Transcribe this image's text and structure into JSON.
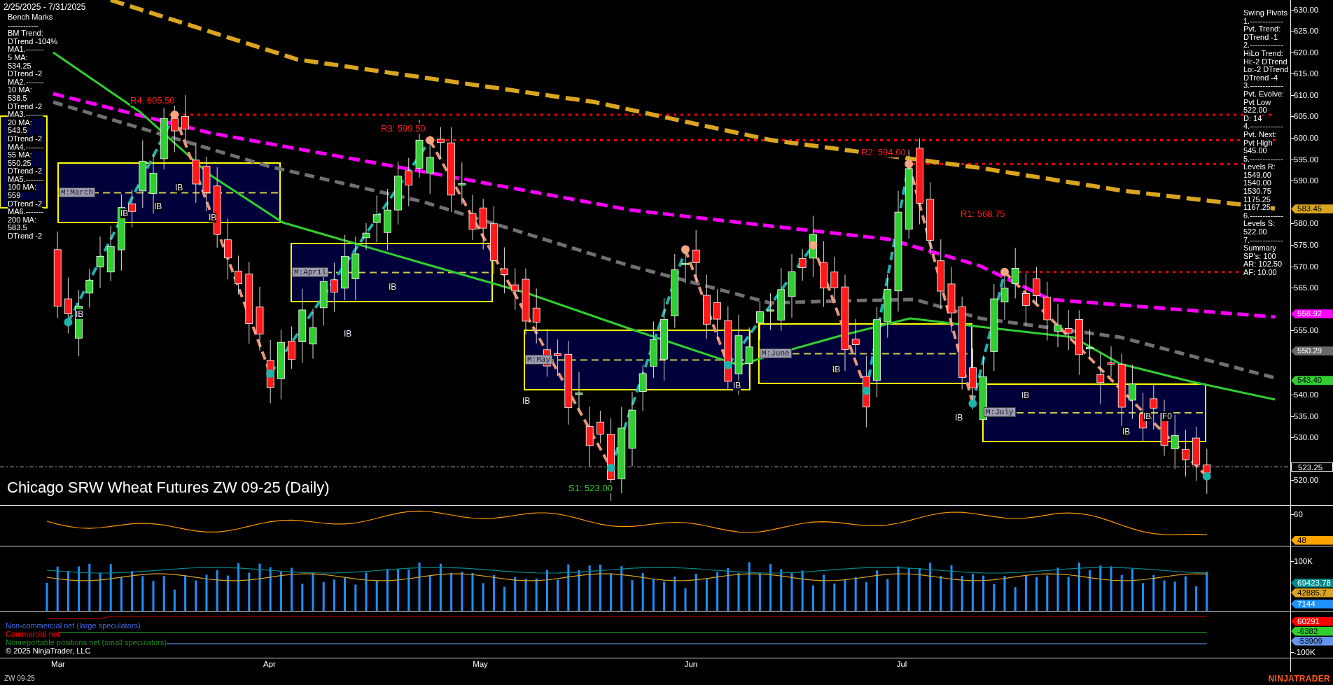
{
  "header": {
    "date_range": "2/25/2025 - 7/31/2025"
  },
  "benchmarks": {
    "lines": [
      "Bench Marks",
      "------------",
      "BM Trend:",
      "DTrend -104%",
      "MA1.-------",
      "5 MA:",
      "534.25",
      "DTrend -2",
      "MA2.-------",
      "10 MA:",
      "538.5",
      "DTrend -2",
      "MA3.-------",
      "20 MA:",
      "543.5",
      "DTrend -2",
      "MA4.-------",
      "55 MA:",
      "550.25",
      "DTrend -2",
      "MA5.-------",
      "100 MA:",
      "559",
      "DTrend -2",
      "MA6.-------",
      "200 MA:",
      "583.5",
      "DTrend -2"
    ]
  },
  "swing_pivots": {
    "lines": [
      "Swing Pivots",
      "1.-------------",
      "Pvt. Trend:",
      "DTrend -1",
      "2.-------------",
      "HiLo Trend:",
      "Hi:-2 DTrend",
      "Lo:-2 DTrend",
      "DTrend -4",
      "3.-------------",
      "Pvt. Evolve:",
      "Pvt Low",
      "522.00",
      "D: 14",
      "4.-------------",
      "Pvt. Next:",
      "Pvt High",
      "545.00",
      "5.-------------",
      "Levels R:",
      "1549.00",
      "1540.00",
      "1530.75",
      "1175.25",
      "1167.25",
      "6.-------------",
      "Levels S:",
      "522.00",
      "7.-------------",
      "Summary",
      "SP's: 100",
      "AR: 102.50",
      "AF: 10.00"
    ]
  },
  "chart": {
    "title": "Chicago SRW Wheat Futures ZW 09-25 (Daily)",
    "levels": [
      {
        "label": "R4: 605.50",
        "kind": "resistance"
      },
      {
        "label": "R3: 599.50",
        "kind": "resistance"
      },
      {
        "label": "R2: 594.00",
        "kind": "resistance"
      },
      {
        "label": "R1: 568.75",
        "kind": "resistance"
      },
      {
        "label": "S1: 523.00",
        "kind": "support"
      }
    ],
    "month_boxes": [
      "M:March",
      "M:April",
      "M:May",
      "M:June",
      "M:July"
    ],
    "bar_labels": [
      "IB",
      "IB",
      "IB",
      "IB",
      "IB",
      "IB",
      "IB",
      "IB",
      "IB",
      "IB",
      "IB",
      "IB",
      "IB",
      "IB",
      "F0"
    ]
  },
  "price_axis": {
    "ticks": [
      "630.00",
      "625.00",
      "620.00",
      "615.00",
      "610.00",
      "605.00",
      "600.00",
      "595.00",
      "590.00",
      "580.00",
      "575.00",
      "570.00",
      "565.00",
      "555.00",
      "540.00",
      "535.00",
      "530.00",
      "520.00"
    ],
    "badges": [
      {
        "value": "583.45",
        "color": "#daa520"
      },
      {
        "value": "558.92",
        "color": "#ff00ff"
      },
      {
        "value": "550.29",
        "color": "#696969"
      },
      {
        "value": "543.40",
        "color": "#32cd32"
      },
      {
        "value": "523.25",
        "color": "#000000"
      }
    ]
  },
  "oscillator_panel": {
    "ticks": [
      "60"
    ],
    "badges": [
      {
        "value": "48",
        "color": "#ffa500"
      }
    ]
  },
  "volume_panel": {
    "ticks": [
      "100K"
    ],
    "badges": [
      {
        "value": "69423.78",
        "color": "#008b8b"
      },
      {
        "value": "42885.7",
        "color": "#daa520"
      },
      {
        "value": "7144",
        "color": "#1e90ff"
      }
    ]
  },
  "cot_panel": {
    "legend": [
      {
        "label": "Non-commercial net (large speculators)",
        "color": "#4169e1"
      },
      {
        "label": "Commercial net",
        "color": "#ff0000"
      },
      {
        "label": "Nonreportable positions net (small speculators)",
        "color": "#228b22"
      }
    ],
    "copyright": "© 2025 NinjaTrader, LLC",
    "ticks": [
      "-100K"
    ],
    "badges": [
      {
        "value": "60291",
        "color": "#ff0000"
      },
      {
        "value": "-6382",
        "color": "#32cd32"
      },
      {
        "value": "-53909",
        "color": "#6495ed"
      }
    ]
  },
  "time_axis": {
    "labels": [
      "Mar",
      "Apr",
      "May",
      "Jun",
      "Jul"
    ]
  },
  "footer": {
    "instrument": "ZW 09-25",
    "logo": "NINJATRADER"
  }
}
